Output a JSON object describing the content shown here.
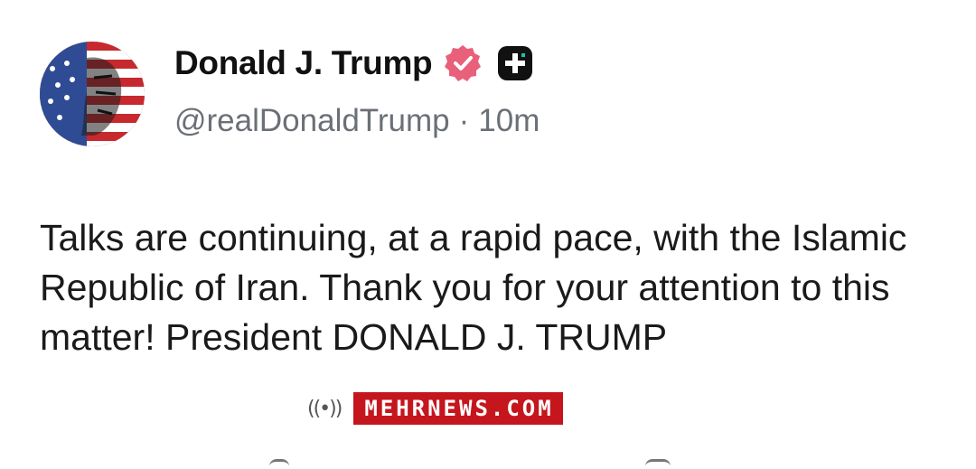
{
  "post": {
    "author_name": "Donald J. Trump",
    "handle": "@realDonaldTrump",
    "separator": "·",
    "time_ago": "10m",
    "text": "Talks are continuing, at a rapid pace, with the Islamic Republic of Iran. Thank you for your attention to this matter! President DONALD J. TRUMP"
  },
  "icons": {
    "verified": "verified-badge-icon",
    "plus": "plus-badge-icon",
    "broadcast": "broadcast-icon"
  },
  "watermark": {
    "label": "MEHRNEWS.COM",
    "bg_color": "#c4161c"
  },
  "colors": {
    "verified_badge": "#e8607a",
    "meta_text": "#6b6f76"
  }
}
